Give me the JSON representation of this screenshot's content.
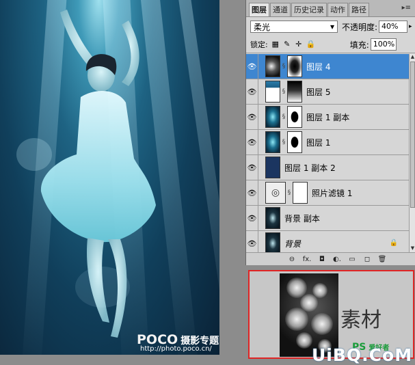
{
  "photo": {
    "watermark_brand": "POCO",
    "watermark_sub": "摄影专题",
    "watermark_url": "http://photo.poco.cn/"
  },
  "panel": {
    "tabs": [
      {
        "label": "图层",
        "active": true
      },
      {
        "label": "通道",
        "active": false
      },
      {
        "label": "历史记录",
        "active": false
      },
      {
        "label": "动作",
        "active": false
      },
      {
        "label": "路径",
        "active": false
      }
    ],
    "menu_icon": "panel-menu-icon",
    "blend_mode": "柔光",
    "opacity_label": "不透明度:",
    "opacity_value": "40%",
    "lock_label": "锁定:",
    "fill_label": "填充:",
    "fill_value": "100%",
    "layers": [
      {
        "name": "图层 4",
        "selected": true,
        "has_mask": true,
        "italic": false
      },
      {
        "name": "图层 5",
        "selected": false,
        "has_mask": true,
        "italic": false
      },
      {
        "name": "图层 1 副本",
        "selected": false,
        "has_mask": true,
        "italic": false
      },
      {
        "name": "图层 1",
        "selected": false,
        "has_mask": true,
        "italic": false
      },
      {
        "name": "图层 1 副本 2",
        "selected": false,
        "has_mask": false,
        "italic": false
      },
      {
        "name": "照片滤镜 1",
        "selected": false,
        "has_mask": true,
        "italic": false
      },
      {
        "name": "背景 副本",
        "selected": false,
        "has_mask": false,
        "italic": false
      },
      {
        "name": "背景",
        "selected": false,
        "has_mask": false,
        "italic": true,
        "locked": true
      }
    ],
    "bottom_buttons": [
      "link-icon",
      "fx-icon",
      "mask-icon",
      "adjustment-icon",
      "group-icon",
      "new-layer-icon",
      "trash-icon"
    ],
    "bottom_glyphs": [
      "⊖",
      "fx.",
      "◘",
      "◐.",
      "▭",
      "◻",
      "🗑"
    ]
  },
  "material": {
    "title": "素材",
    "logo": "PS",
    "logo_sub": "爱好者"
  },
  "site_mark": "UiBQ.CoM",
  "colors": {
    "selection": "#3e86d0",
    "highlight_border": "#e02424"
  }
}
